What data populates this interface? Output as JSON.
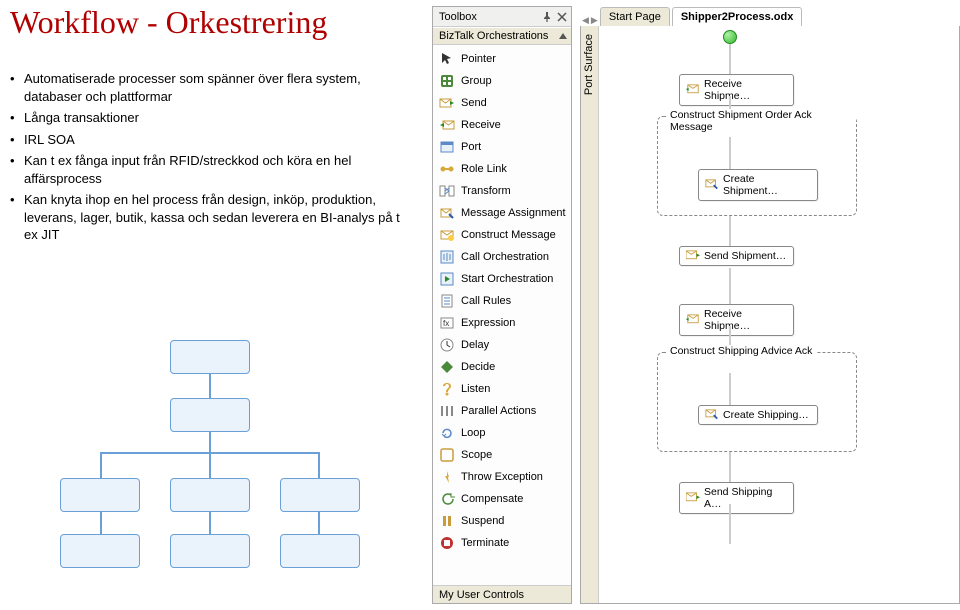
{
  "title": "Workflow - Orkestrering",
  "bullets": [
    "Automatiserade processer som spänner över flera system, databaser och plattformar",
    "Långa transaktioner",
    "IRL SOA",
    "Kan t ex fånga input från RFID/streckkod och köra en hel affärsprocess",
    "Kan knyta ihop en hel process från design, inköp, produktion, leverans, lager, butik, kassa och sedan leverera en BI-analys på t ex JIT"
  ],
  "toolbox": {
    "title": "Toolbox",
    "category": "BizTalk Orchestrations",
    "items": [
      {
        "icon": "pointer",
        "label": "Pointer"
      },
      {
        "icon": "group",
        "label": "Group"
      },
      {
        "icon": "send",
        "label": "Send"
      },
      {
        "icon": "receive",
        "label": "Receive"
      },
      {
        "icon": "port",
        "label": "Port"
      },
      {
        "icon": "rolelink",
        "label": "Role Link"
      },
      {
        "icon": "transform",
        "label": "Transform"
      },
      {
        "icon": "msgassign",
        "label": "Message Assignment"
      },
      {
        "icon": "constructmsg",
        "label": "Construct Message"
      },
      {
        "icon": "callorch",
        "label": "Call Orchestration"
      },
      {
        "icon": "startorch",
        "label": "Start Orchestration"
      },
      {
        "icon": "callrules",
        "label": "Call Rules"
      },
      {
        "icon": "expression",
        "label": "Expression"
      },
      {
        "icon": "delay",
        "label": "Delay"
      },
      {
        "icon": "decide",
        "label": "Decide"
      },
      {
        "icon": "listen",
        "label": "Listen"
      },
      {
        "icon": "parallel",
        "label": "Parallel Actions"
      },
      {
        "icon": "loop",
        "label": "Loop"
      },
      {
        "icon": "scope",
        "label": "Scope"
      },
      {
        "icon": "throw",
        "label": "Throw Exception"
      },
      {
        "icon": "compensate",
        "label": "Compensate"
      },
      {
        "icon": "suspend",
        "label": "Suspend"
      },
      {
        "icon": "terminate",
        "label": "Terminate"
      }
    ],
    "bottom": "My User Controls"
  },
  "tabs": {
    "start": "Start Page",
    "active": "Shipper2Process.odx"
  },
  "port_surface": "Port Surface",
  "shapes": {
    "receive1": "Receive  Shipme…",
    "group1": "Construct Shipment Order Ack Message",
    "create1": "Create  Shipment…",
    "send1": "Send  Shipment…",
    "receive2": "Receive  Shipme…",
    "group2": "Construct Shipping Advice Ack",
    "create2": "Create  Shipping…",
    "send2": "Send  Shipping A…"
  }
}
